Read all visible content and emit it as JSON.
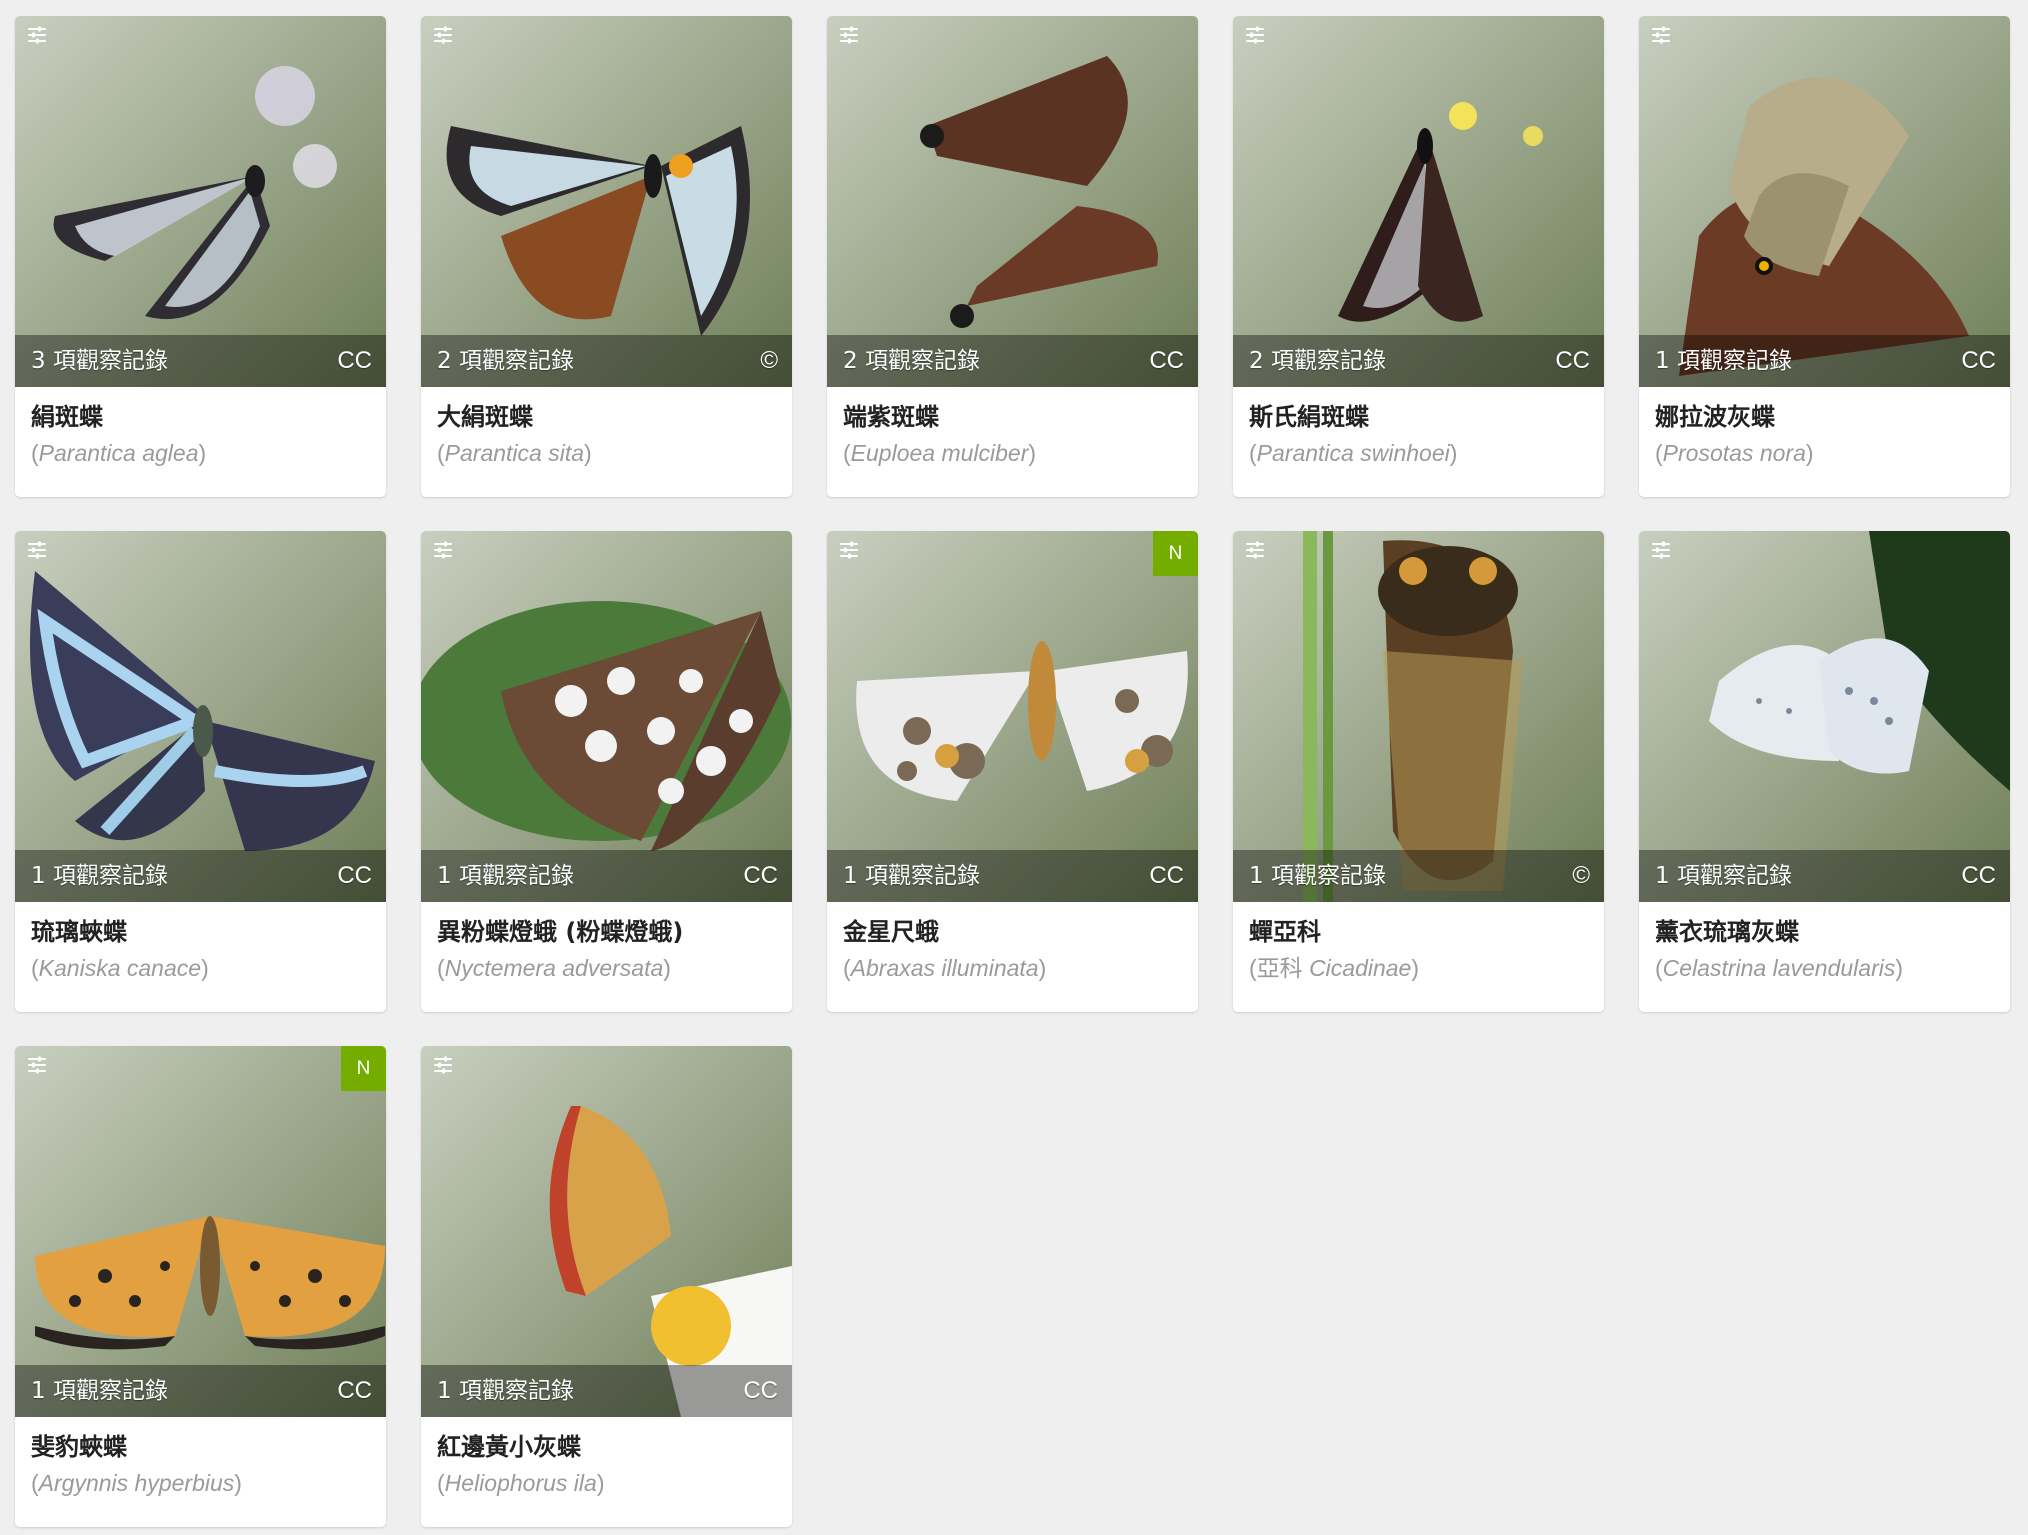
{
  "colors": {
    "background": "#efefef",
    "card": "#ffffff",
    "native_badge": "#74ac00",
    "common_name": "#222222",
    "sci_name": "#9a9a9a"
  },
  "icons": {
    "settings": "sliders-icon"
  },
  "cards": [
    {
      "obs": "3 項觀察記錄",
      "license": "CC",
      "native": "",
      "common": "絹斑蝶",
      "sci_open": "(",
      "sci": "Parantica aglea",
      "sci_close": ")",
      "rank": "",
      "photo": "butterfly-glassy-tiger"
    },
    {
      "obs": "2 項觀察記錄",
      "license": "©",
      "native": "",
      "common": "大絹斑蝶",
      "sci_open": "(",
      "sci": "Parantica sita",
      "sci_close": ")",
      "rank": "",
      "photo": "butterfly-chestnut-tiger"
    },
    {
      "obs": "2 項觀察記錄",
      "license": "CC",
      "native": "",
      "common": "端紫斑蝶",
      "sci_open": "(",
      "sci": "Euploea mulciber",
      "sci_close": ")",
      "rank": "",
      "photo": "butterfly-striped-crow"
    },
    {
      "obs": "2 項觀察記錄",
      "license": "CC",
      "native": "",
      "common": "斯氏絹斑蝶",
      "sci_open": "(",
      "sci": "Parantica swinhoei",
      "sci_close": ")",
      "rank": "",
      "photo": "butterfly-swinhoe-tiger"
    },
    {
      "obs": "1 項觀察記錄",
      "license": "CC",
      "native": "",
      "common": "娜拉波灰蝶",
      "sci_open": "(",
      "sci": "Prosotas nora",
      "sci_close": ")",
      "rank": "",
      "photo": "butterfly-common-lineblue"
    },
    {
      "obs": "1 項觀察記錄",
      "license": "CC",
      "native": "",
      "common": "琉璃蛺蝶",
      "sci_open": "(",
      "sci": "Kaniska canace",
      "sci_close": ")",
      "rank": "",
      "photo": "butterfly-blue-admiral"
    },
    {
      "obs": "1 項觀察記錄",
      "license": "CC",
      "native": "",
      "common": "異粉蝶燈蛾 (粉蝶燈蛾)",
      "sci_open": "(",
      "sci": "Nyctemera adversata",
      "sci_close": ")",
      "rank": "",
      "photo": "moth-nyctemera"
    },
    {
      "obs": "1 項觀察記錄",
      "license": "CC",
      "native": "N",
      "common": "金星尺蛾",
      "sci_open": "(",
      "sci": "Abraxas illuminata",
      "sci_close": ")",
      "rank": "",
      "photo": "moth-abraxas"
    },
    {
      "obs": "1 項觀察記錄",
      "license": "©",
      "native": "",
      "common": "蟬亞科",
      "sci_open": "(",
      "sci": "Cicadinae",
      "sci_close": ")",
      "rank": "亞科 ",
      "photo": "cicada"
    },
    {
      "obs": "1 項觀察記錄",
      "license": "CC",
      "native": "",
      "common": "薰衣琉璃灰蝶",
      "sci_open": "(",
      "sci": "Celastrina lavendularis",
      "sci_close": ")",
      "rank": "",
      "photo": "butterfly-plain-hedge-blue"
    },
    {
      "obs": "1 項觀察記錄",
      "license": "CC",
      "native": "N",
      "common": "斐豹蛺蝶",
      "sci_open": "(",
      "sci": "Argynnis hyperbius",
      "sci_close": ")",
      "rank": "",
      "photo": "butterfly-fritillary"
    },
    {
      "obs": "1 項觀察記錄",
      "license": "CC",
      "native": "",
      "common": "紅邊黃小灰蝶",
      "sci_open": "(",
      "sci": "Heliophorus ila",
      "sci_close": ")",
      "rank": "",
      "photo": "butterfly-sapphire"
    }
  ]
}
